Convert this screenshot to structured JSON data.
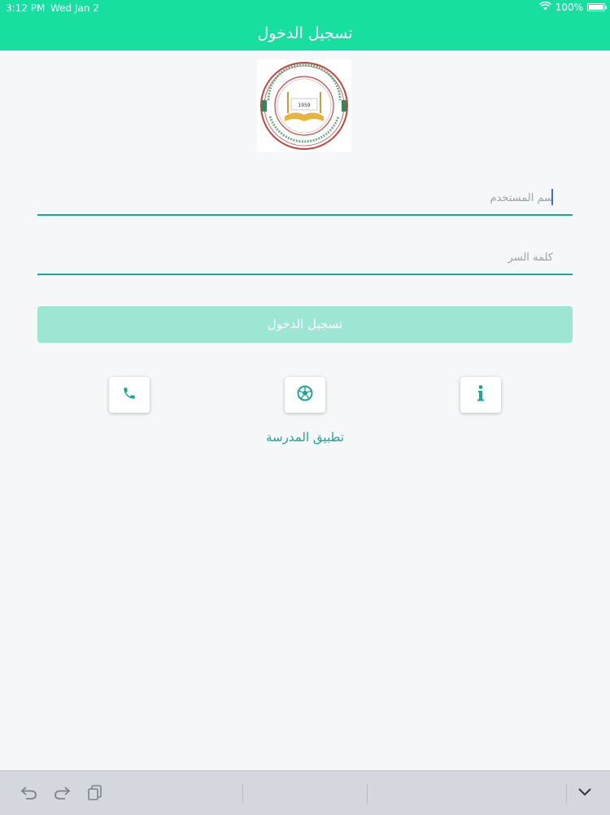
{
  "status_bar": {
    "time": "3:12 PM",
    "date": "Wed Jan 2",
    "battery": "100%"
  },
  "header": {
    "title": "تسجيل الدخول"
  },
  "logo": {
    "year": "1959"
  },
  "form": {
    "username_placeholder": "سم المستخدم",
    "password_placeholder": "كلمه السر",
    "login_label": "تسجيل الدخول"
  },
  "actions": [
    {
      "icon": "phone-icon"
    },
    {
      "icon": "soccer-ball-icon"
    },
    {
      "icon": "info-icon"
    }
  ],
  "app_link": "تطبيق المدرسة",
  "keyboard_toolbar": {
    "icons": [
      "undo-icon",
      "redo-icon",
      "paste-icon",
      "chevron-down-icon"
    ]
  },
  "colors": {
    "accent": "#17df9f",
    "teal": "#1fa593",
    "button_disabled": "#9de6d3"
  }
}
